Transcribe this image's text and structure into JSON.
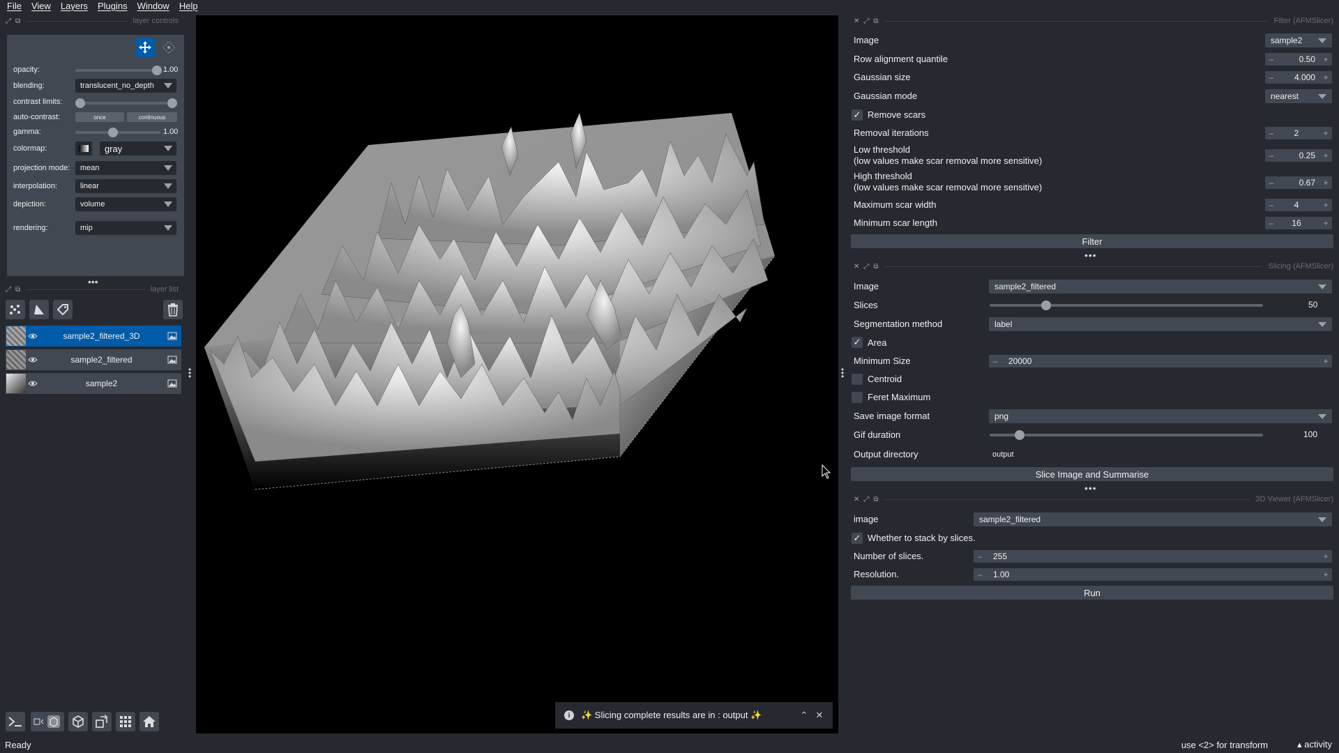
{
  "menu": [
    "File",
    "View",
    "Layers",
    "Plugins",
    "Window",
    "Help"
  ],
  "layer_controls": {
    "title": "layer controls",
    "opacity_label": "opacity:",
    "opacity_value": "1.00",
    "blending_label": "blending:",
    "blending_value": "translucent_no_depth",
    "contrast_label": "contrast limits:",
    "autocontrast_label": "auto-contrast:",
    "autocontrast_once": "once",
    "autocontrast_continuous": "continuous",
    "gamma_label": "gamma:",
    "gamma_value": "1.00",
    "colormap_label": "colormap:",
    "colormap_value": "gray",
    "projection_label": "projection mode:",
    "projection_value": "mean",
    "interpolation_label": "interpolation:",
    "interpolation_value": "linear",
    "depiction_label": "depiction:",
    "depiction_value": "volume",
    "rendering_label": "rendering:",
    "rendering_value": "mip"
  },
  "layer_list": {
    "title": "layer list",
    "layers": [
      {
        "name": "sample2_filtered_3D",
        "selected": true
      },
      {
        "name": "sample2_filtered",
        "selected": false
      },
      {
        "name": "sample2",
        "selected": false
      }
    ]
  },
  "filter_panel": {
    "title": "Filter (AFMSlicer)",
    "image_label": "Image",
    "image_value": "sample2",
    "row_align_label": "Row alignment quantile",
    "row_align_value": "0.50",
    "gauss_size_label": "Gaussian size",
    "gauss_size_value": "4.000",
    "gauss_mode_label": "Gaussian mode",
    "gauss_mode_value": "nearest",
    "remove_scars_label": "Remove scars",
    "removal_iter_label": "Removal iterations",
    "removal_iter_value": "2",
    "low_thresh_label": "Low threshold",
    "low_thresh_sub": "(low values make scar removal more sensitive)",
    "low_thresh_value": "0.25",
    "high_thresh_label": "High threshold",
    "high_thresh_sub": "(low values make scar removal more sensitive)",
    "high_thresh_value": "0.67",
    "max_scar_width_label": "Maximum scar width",
    "max_scar_width_value": "4",
    "min_scar_length_label": "Minimum scar length",
    "min_scar_length_value": "16",
    "filter_button": "Filter"
  },
  "slicing_panel": {
    "title": "Slicing (AFMSlicer)",
    "image_label": "Image",
    "image_value": "sample2_filtered",
    "slices_label": "Slices",
    "slices_value": "50",
    "seg_label": "Segmentation method",
    "seg_value": "label",
    "area_label": "Area",
    "min_size_label": "Minimum Size",
    "min_size_value": "20000",
    "centroid_label": "Centroid",
    "feret_label": "Feret Maximum",
    "save_format_label": "Save image format",
    "save_format_value": "png",
    "gif_label": "Gif duration",
    "gif_value": "100",
    "output_label": "Output directory",
    "output_value": "output",
    "slice_button": "Slice Image and Summarise"
  },
  "viewer_panel": {
    "title": "3D Viewer (AFMSlicer)",
    "image_label": "image",
    "image_value": "sample2_filtered",
    "stack_label": "Whether to stack by slices.",
    "num_slices_label": "Number of slices.",
    "num_slices_value": "255",
    "resolution_label": "Resolution.",
    "resolution_value": "1.00",
    "run_button": "Run"
  },
  "toast": {
    "message": "✨ Slicing complete results are in  : output ✨"
  },
  "status": {
    "left": "Ready",
    "hint": "use <2> for transform",
    "activity": "▴ activity"
  }
}
